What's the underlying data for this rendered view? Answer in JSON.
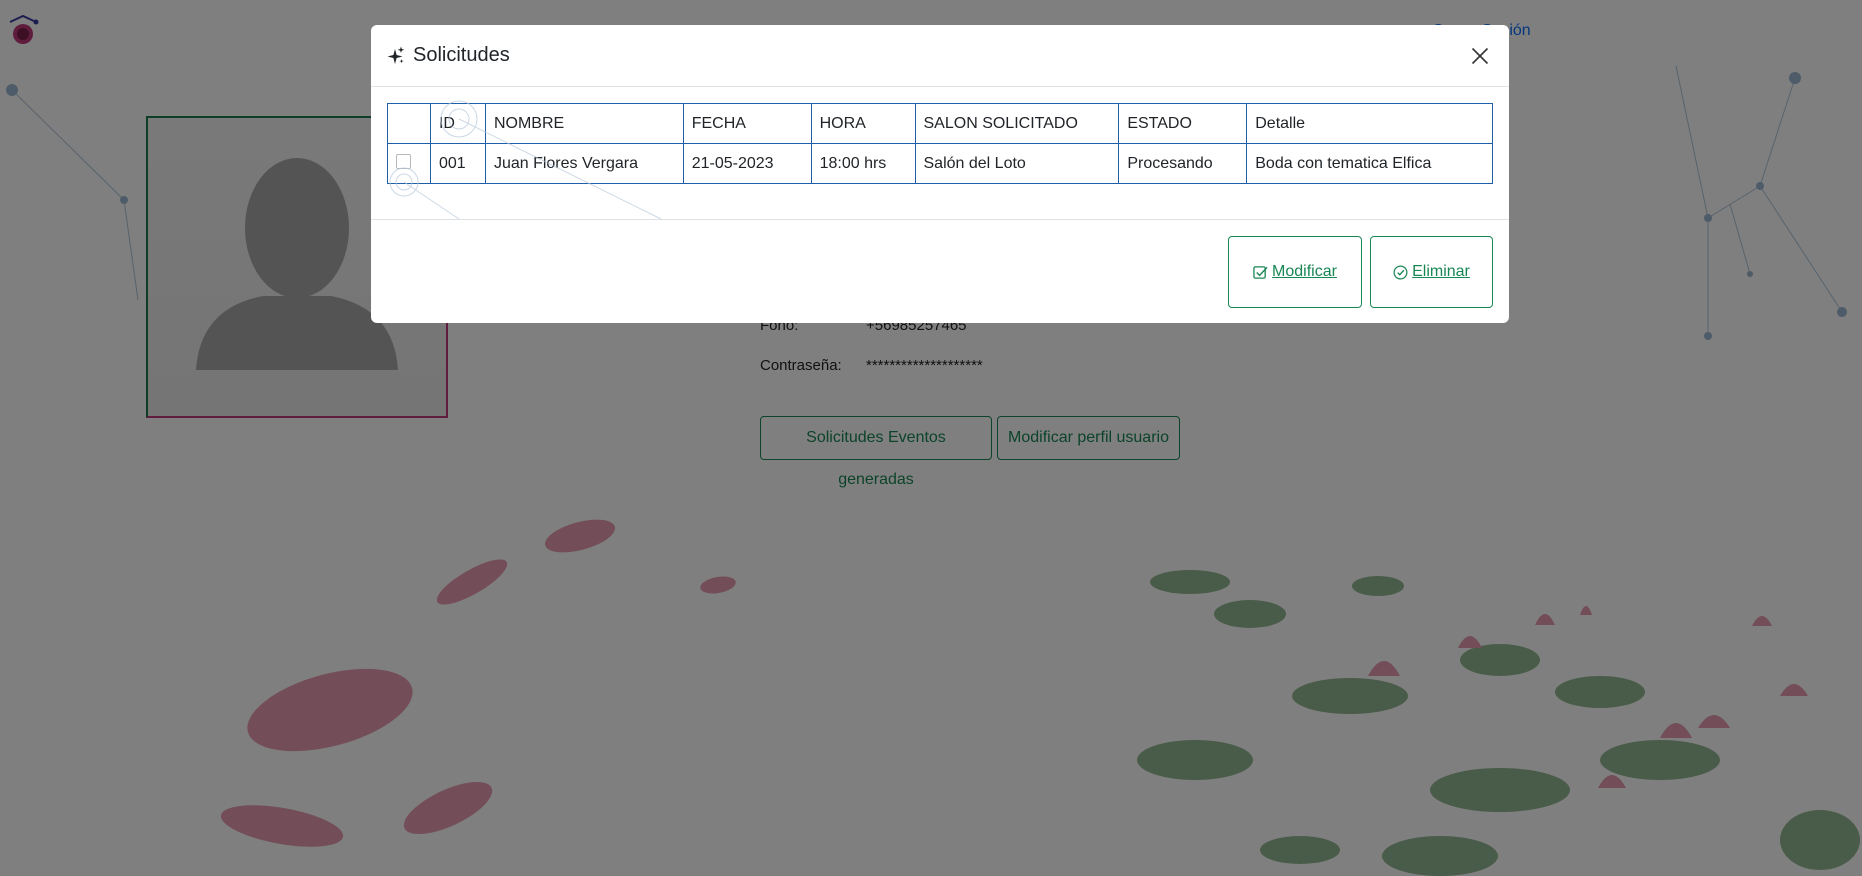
{
  "header": {
    "right_link": "Cerrar Sesión"
  },
  "profile": {
    "fono_label": "Fono:",
    "fono_value": "+56985257465",
    "password_label": "Contraseña:",
    "password_value": "********************",
    "buttons": {
      "requests": "Solicitudes Eventos generadas",
      "edit_profile": "Modificar perfil usuario"
    }
  },
  "modal": {
    "title": "Solicitudes",
    "title_icon": "sparkles-icon",
    "close_icon": "close-icon",
    "table": {
      "headers": [
        "",
        "ID",
        "NOMBRE",
        "FECHA",
        "HORA",
        "SALON SOLICITADO",
        "ESTADO",
        "Detalle"
      ],
      "rows": [
        {
          "checked": false,
          "id": "001",
          "nombre": "Juan Flores Vergara",
          "fecha": "21-05-2023",
          "hora": "18:00 hrs",
          "salon": "Salón del Loto",
          "estado": "Procesando",
          "detalle": "Boda con tematica Elfica"
        }
      ]
    },
    "buttons": {
      "modify": "Modificar",
      "modify_icon": "check-square-icon",
      "delete": "Eliminar",
      "delete_icon": "check-circle-icon"
    }
  },
  "colors": {
    "accent_green": "#198754",
    "table_border": "#1f5fa8",
    "link_blue": "#0d6efd",
    "overlay": "rgba(0,0,0,0.5)"
  }
}
